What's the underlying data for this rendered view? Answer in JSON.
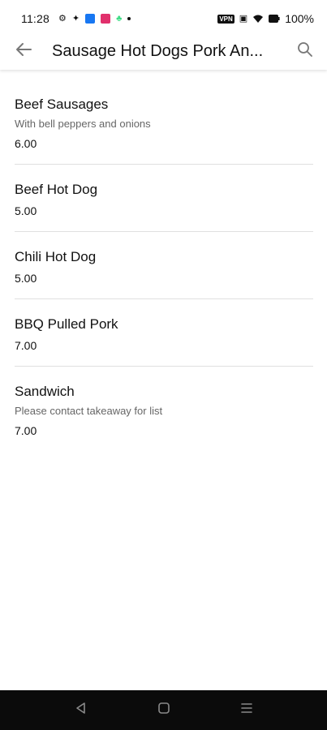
{
  "status_bar": {
    "time": "11:28",
    "battery": "100%",
    "vpn_label": "VPN",
    "icons": [
      "gear-icon",
      "fan-icon",
      "messenger-icon",
      "instagram-icon",
      "android-icon",
      "dot-icon",
      "vpn-icon",
      "vibrate-icon",
      "wifi-icon",
      "battery-icon"
    ]
  },
  "header": {
    "title": "Sausage Hot Dogs Pork An...",
    "back_icon": "arrow-left-icon",
    "search_icon": "search-icon"
  },
  "menu_items": [
    {
      "name": "Beef Sausages",
      "description": "With bell peppers and onions",
      "price": "6.00"
    },
    {
      "name": "Beef Hot Dog",
      "description": "",
      "price": "5.00"
    },
    {
      "name": "Chili Hot Dog",
      "description": "",
      "price": "5.00"
    },
    {
      "name": "BBQ Pulled Pork",
      "description": "",
      "price": "7.00"
    },
    {
      "name": "Sandwich",
      "description": "Please contact takeaway for list",
      "price": "7.00"
    }
  ],
  "nav_bar": {
    "icons": [
      "back-triangle-icon",
      "home-square-icon",
      "recents-menu-icon"
    ]
  },
  "colors": {
    "divider": "#e0e0e0",
    "secondary_text": "#666666",
    "nav_background": "#0b0b0b",
    "messenger_blue": "#1877f2",
    "instagram_pink": "#e1306c",
    "android_green": "#3ddc84"
  }
}
